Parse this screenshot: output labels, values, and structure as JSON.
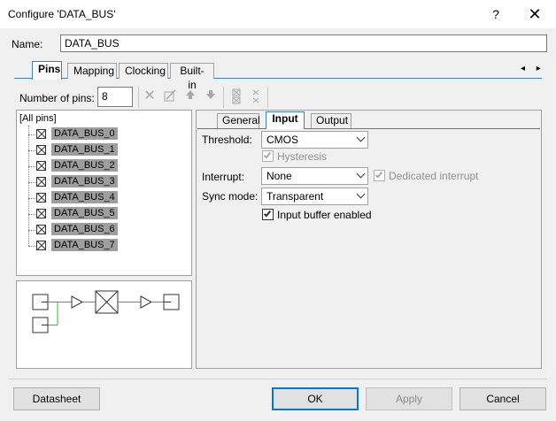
{
  "window": {
    "title": "Configure 'DATA_BUS'",
    "help_glyph": "?",
    "close_glyph": "✕"
  },
  "name": {
    "label": "Name:",
    "value": "DATA_BUS"
  },
  "main_tabs": [
    {
      "label": "Pins",
      "active": true
    },
    {
      "label": "Mapping",
      "active": false
    },
    {
      "label": "Clocking",
      "active": false
    },
    {
      "label": "Built-in",
      "active": false
    }
  ],
  "nav_arrows": "◂ ▸",
  "pins_toolbar": {
    "number_label": "Number of pins:",
    "number_value": "8",
    "icons": [
      "delete-icon",
      "edit-pin-icon",
      "move-up-icon",
      "move-down-icon",
      "group-icon",
      "ungroup-icon"
    ]
  },
  "pin_tree": {
    "root": "[All pins]",
    "pins": [
      "DATA_BUS_0",
      "DATA_BUS_1",
      "DATA_BUS_2",
      "DATA_BUS_3",
      "DATA_BUS_4",
      "DATA_BUS_5",
      "DATA_BUS_6",
      "DATA_BUS_7"
    ]
  },
  "sub_tabs": [
    {
      "label": "General",
      "active": false
    },
    {
      "label": "Input",
      "active": true
    },
    {
      "label": "Output",
      "active": false
    }
  ],
  "input_form": {
    "threshold_label": "Threshold:",
    "threshold_value": "CMOS",
    "hysteresis_label": "Hysteresis",
    "interrupt_label": "Interrupt:",
    "interrupt_value": "None",
    "dedicated_interrupt_label": "Dedicated interrupt",
    "sync_mode_label": "Sync mode:",
    "sync_mode_value": "Transparent",
    "input_buffer_label": "Input buffer enabled",
    "input_buffer_checked": true
  },
  "buttons": {
    "datasheet": "Datasheet",
    "ok": "OK",
    "apply": "Apply",
    "cancel": "Cancel"
  },
  "colors": {
    "tab_accent": "#3c7fb1",
    "default_button_border": "#0078d7",
    "pin_highlight": "#9e9e9e",
    "schematic_wire": "#22c322"
  }
}
